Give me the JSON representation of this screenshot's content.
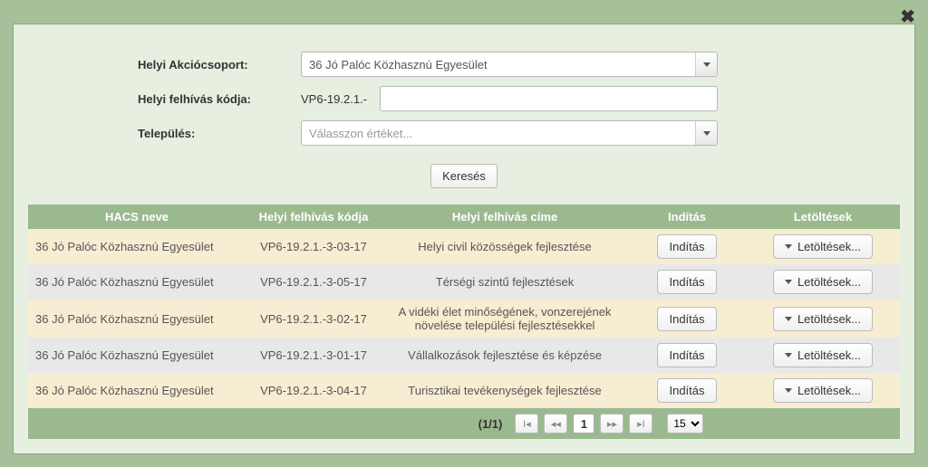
{
  "form": {
    "group_label": "Helyi Akciócsoport:",
    "group_value": "36 Jó Palóc Közhasznú Egyesület",
    "code_label": "Helyi felhívás kódja:",
    "code_prefix": "VP6-19.2.1.-",
    "code_value": "",
    "settlement_label": "Település:",
    "settlement_value": "Válasszon értéket..."
  },
  "search_button": "Keresés",
  "columns": {
    "hacs": "HACS neve",
    "code": "Helyi felhívás kódja",
    "title": "Helyi felhívás címe",
    "start": "Indítás",
    "downloads": "Letöltések"
  },
  "action_labels": {
    "start": "Indítás",
    "download": "Letöltések..."
  },
  "rows": [
    {
      "hacs": "36 Jó Palóc Közhasznú Egyesület",
      "code": "VP6-19.2.1.-3-03-17",
      "title": "Helyi civil közösségek fejlesztése"
    },
    {
      "hacs": "36 Jó Palóc Közhasznú Egyesület",
      "code": "VP6-19.2.1.-3-05-17",
      "title": "Térségi szintű fejlesztések"
    },
    {
      "hacs": "36 Jó Palóc Közhasznú Egyesület",
      "code": "VP6-19.2.1.-3-02-17",
      "title": "A vidéki élet minőségének, vonzerejének növelése települési fejlesztésekkel"
    },
    {
      "hacs": "36 Jó Palóc Közhasznú Egyesület",
      "code": "VP6-19.2.1.-3-01-17",
      "title": "Vállalkozások fejlesztése és képzése"
    },
    {
      "hacs": "36 Jó Palóc Közhasznú Egyesület",
      "code": "VP6-19.2.1.-3-04-17",
      "title": "Turisztikai tevékenységek fejlesztése"
    }
  ],
  "pager": {
    "info": "(1/1)",
    "current": "1",
    "page_size": "15"
  }
}
